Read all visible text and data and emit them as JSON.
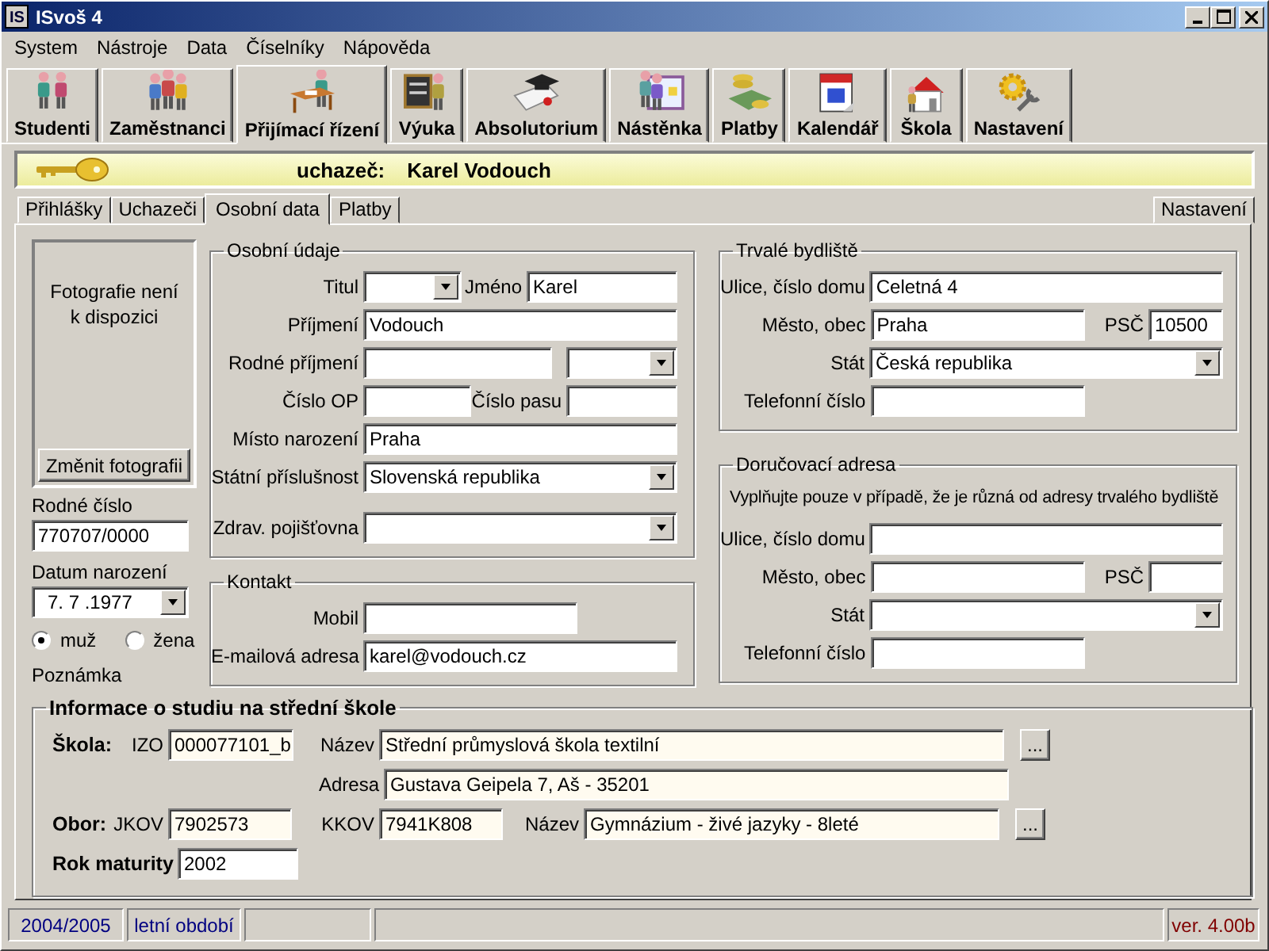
{
  "window": {
    "logo": "IS",
    "title": "ISvoš 4"
  },
  "menu": [
    "System",
    "Nástroje",
    "Data",
    "Číselníky",
    "Nápověda"
  ],
  "modules": [
    {
      "label": "Studenti",
      "selected": false
    },
    {
      "label": "Zaměstnanci",
      "selected": false
    },
    {
      "label": "Přijímací řízení",
      "selected": true
    },
    {
      "label": "Výuka",
      "selected": false
    },
    {
      "label": "Absolutorium",
      "selected": false
    },
    {
      "label": "Nástěnka",
      "selected": false
    },
    {
      "label": "Platby",
      "selected": false
    },
    {
      "label": "Kalendář",
      "selected": false
    },
    {
      "label": "Škola",
      "selected": false
    },
    {
      "label": "Nastavení",
      "selected": false
    }
  ],
  "banner": {
    "label": "uchazeč:",
    "name": "Karel Vodouch"
  },
  "tabs": [
    {
      "label": "Přihlášky",
      "selected": false
    },
    {
      "label": "Uchazeči",
      "selected": false
    },
    {
      "label": "Osobní data",
      "selected": true
    },
    {
      "label": "Platby",
      "selected": false
    }
  ],
  "settings_tab": {
    "label": "Nastavení"
  },
  "photo": {
    "placeholder": "Fotografie není k dispozici",
    "button": "Změnit fotografii"
  },
  "birth_number": {
    "label": "Rodné číslo",
    "value": "770707/0000"
  },
  "birth_date": {
    "label": "Datum narození",
    "value": "7. 7 .1977"
  },
  "gender": [
    {
      "label": "muž",
      "selected": true
    },
    {
      "label": "žena",
      "selected": false
    }
  ],
  "note": {
    "label": "Poznámka"
  },
  "personal": {
    "title": "Osobní údaje",
    "rows": [
      [
        {
          "label": "Titul",
          "kind": "combo"
        },
        {
          "label": "Jméno",
          "kind": "text",
          "value": "Karel"
        }
      ],
      [
        {
          "label": "Příjmení",
          "kind": "text",
          "value": "Vodouch"
        }
      ],
      [
        {
          "label": "Rodné příjmení",
          "kind": "text"
        },
        {
          "kind": "combo"
        }
      ],
      [
        {
          "label": "Číslo OP",
          "kind": "text"
        },
        {
          "label": "Číslo pasu",
          "kind": "text"
        }
      ],
      [
        {
          "label": "Místo narození",
          "kind": "text",
          "value": "Praha"
        }
      ],
      [
        {
          "label": "Státní příslušnost",
          "kind": "combo",
          "value": "Slovenská republika"
        }
      ],
      [
        {
          "label": "Zdrav. pojišťovna",
          "kind": "combo"
        }
      ]
    ]
  },
  "contact": {
    "title": "Kontakt",
    "rows": [
      [
        {
          "label": "Mobil",
          "kind": "text"
        }
      ],
      [
        {
          "label": "E-mailová adresa",
          "kind": "text",
          "value": "karel@vodouch.cz"
        }
      ]
    ]
  },
  "permanent_address": {
    "title": "Trvalé bydliště",
    "rows": [
      [
        {
          "label": "Ulice, číslo domu",
          "kind": "text",
          "value": "Celetná 4"
        }
      ],
      [
        {
          "label": "Město, obec",
          "kind": "text",
          "value": "Praha"
        },
        {
          "label": "PSČ",
          "kind": "text",
          "value": "10500"
        }
      ],
      [
        {
          "label": "Stát",
          "kind": "combo",
          "value": "Česká republika"
        }
      ],
      [
        {
          "label": "Telefonní číslo",
          "kind": "text"
        }
      ]
    ]
  },
  "delivery_address": {
    "title": "Doručovací adresa",
    "note": "Vyplňujte pouze v případě, že je různá od adresy trvalého bydliště",
    "rows": [
      [
        {
          "label": "Ulice, číslo domu",
          "kind": "text"
        }
      ],
      [
        {
          "label": "Město, obec",
          "kind": "text"
        },
        {
          "label": "PSČ",
          "kind": "text"
        }
      ],
      [
        {
          "label": "Stát",
          "kind": "combo"
        }
      ],
      [
        {
          "label": "Telefonní číslo",
          "kind": "text"
        }
      ]
    ]
  },
  "school_info": {
    "title": "Informace o studiu na střední škole",
    "rows": [
      {
        "heading": "Škola:",
        "fields": [
          {
            "label": "IZO",
            "value": "000077101_b",
            "readonly": true
          },
          {
            "label": "Název",
            "value": "Střední průmyslová škola textilní",
            "readonly": true,
            "button": "..."
          }
        ]
      },
      {
        "fields": [
          {
            "label": "Adresa",
            "value": "Gustava Geipela 7, Aš - 35201",
            "readonly": true
          }
        ]
      },
      {
        "heading": "Obor:",
        "fields": [
          {
            "label": "JKOV",
            "value": "7902573",
            "readonly": true
          },
          {
            "label": "KKOV",
            "value": "7941K808",
            "readonly": true
          },
          {
            "label": "Název",
            "value": "Gymnázium - živé jazyky - 8leté",
            "readonly": true,
            "button": "..."
          }
        ]
      },
      {
        "heading": "Rok maturity",
        "fields": [
          {
            "value": "2002",
            "readonly": false
          }
        ]
      }
    ]
  },
  "status_bar": [
    {
      "text": "2004/2005",
      "color": "#000080"
    },
    {
      "text": "letní období",
      "color": "#000080"
    },
    {
      "text": "ver. 4.00b",
      "color": "#800000"
    }
  ]
}
